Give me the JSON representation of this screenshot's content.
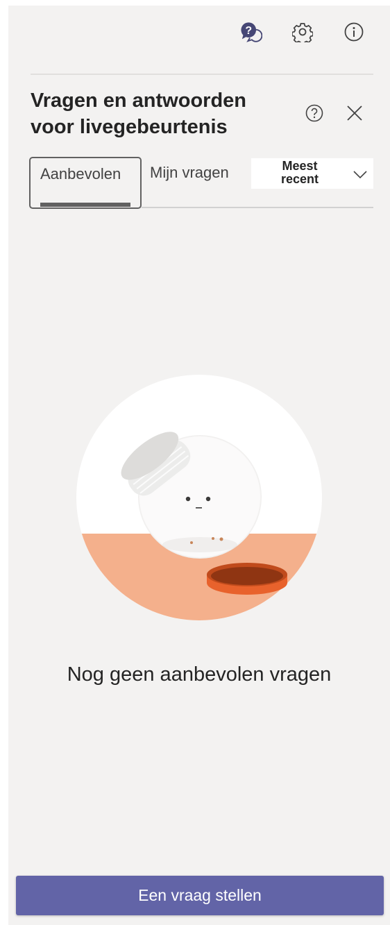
{
  "header_icons": {
    "qa": "qa-chat-icon",
    "settings": "gear-icon",
    "info": "info-icon"
  },
  "panel": {
    "title": "Vragen en antwoorden voor livegebeurtenis",
    "help_icon": "help-icon",
    "close_icon": "close-icon"
  },
  "tabs": {
    "recommended": "Aanbevolen",
    "my_questions": "Mijn vragen",
    "sort_value": "Meest recent",
    "sort_icon": "chevron-down-icon"
  },
  "empty_state": {
    "illustration": "empty-jar-illustration",
    "message": "Nog geen aanbevolen vragen"
  },
  "footer": {
    "ask_button": "Een vraag stellen"
  },
  "colors": {
    "panel_bg": "#f3f2f1",
    "accent": "#6264a7",
    "qa_icon": "#464775",
    "table_surface": "#f4b08c",
    "lid": "#e8622c"
  }
}
